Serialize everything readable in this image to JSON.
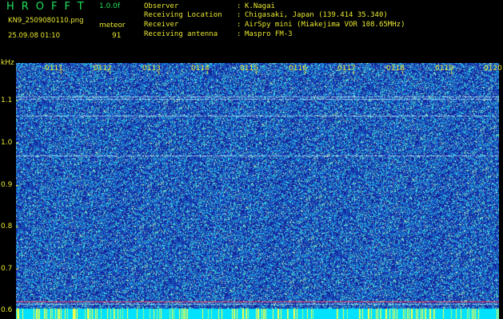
{
  "app": {
    "title": "HROFFT",
    "version": "1.0.0f",
    "filename": "KN9_2509080110.png",
    "datetime": "25.09.08 01:10",
    "meteor_label": "meteor",
    "meteor_count": "91"
  },
  "info": [
    {
      "label": "Observer",
      "value": "K.Nagai"
    },
    {
      "label": "Receiving Location",
      "value": "Chigasaki, Japan (139.414 35.340)"
    },
    {
      "label": "Receiver",
      "value": "AirSpy mini (Miakejima VOR 108.65MHz)"
    },
    {
      "label": "Receiving antenna",
      "value": "Maspro FM-3"
    }
  ],
  "colors": {
    "background": "#000000",
    "text_green": "#21e05a",
    "text_yellow": "#e8e830",
    "spectrogram_base": "#1a2a9a",
    "noise_floor": "#00e0ff",
    "carrier": "#ff4060"
  },
  "chart_data": {
    "type": "heatmap",
    "ylabel": "kHz",
    "y_ticks": [
      "1.1",
      "1.0",
      "0.9",
      "0.8",
      "0.7",
      "0.6"
    ],
    "y_tick_values": [
      1.1,
      1.0,
      0.9,
      0.8,
      0.7,
      0.6
    ],
    "ylim": [
      0.58,
      1.19
    ],
    "x_ticks": [
      "0111",
      "0112",
      "0113",
      "0114",
      "0115",
      "0116",
      "0117",
      "0118",
      "0119",
      "0120"
    ],
    "xlim": [
      0,
      10
    ],
    "horizontal_lines_khz": [
      1.11,
      1.105,
      1.065,
      0.97,
      0.622,
      0.617,
      0.598
    ]
  }
}
